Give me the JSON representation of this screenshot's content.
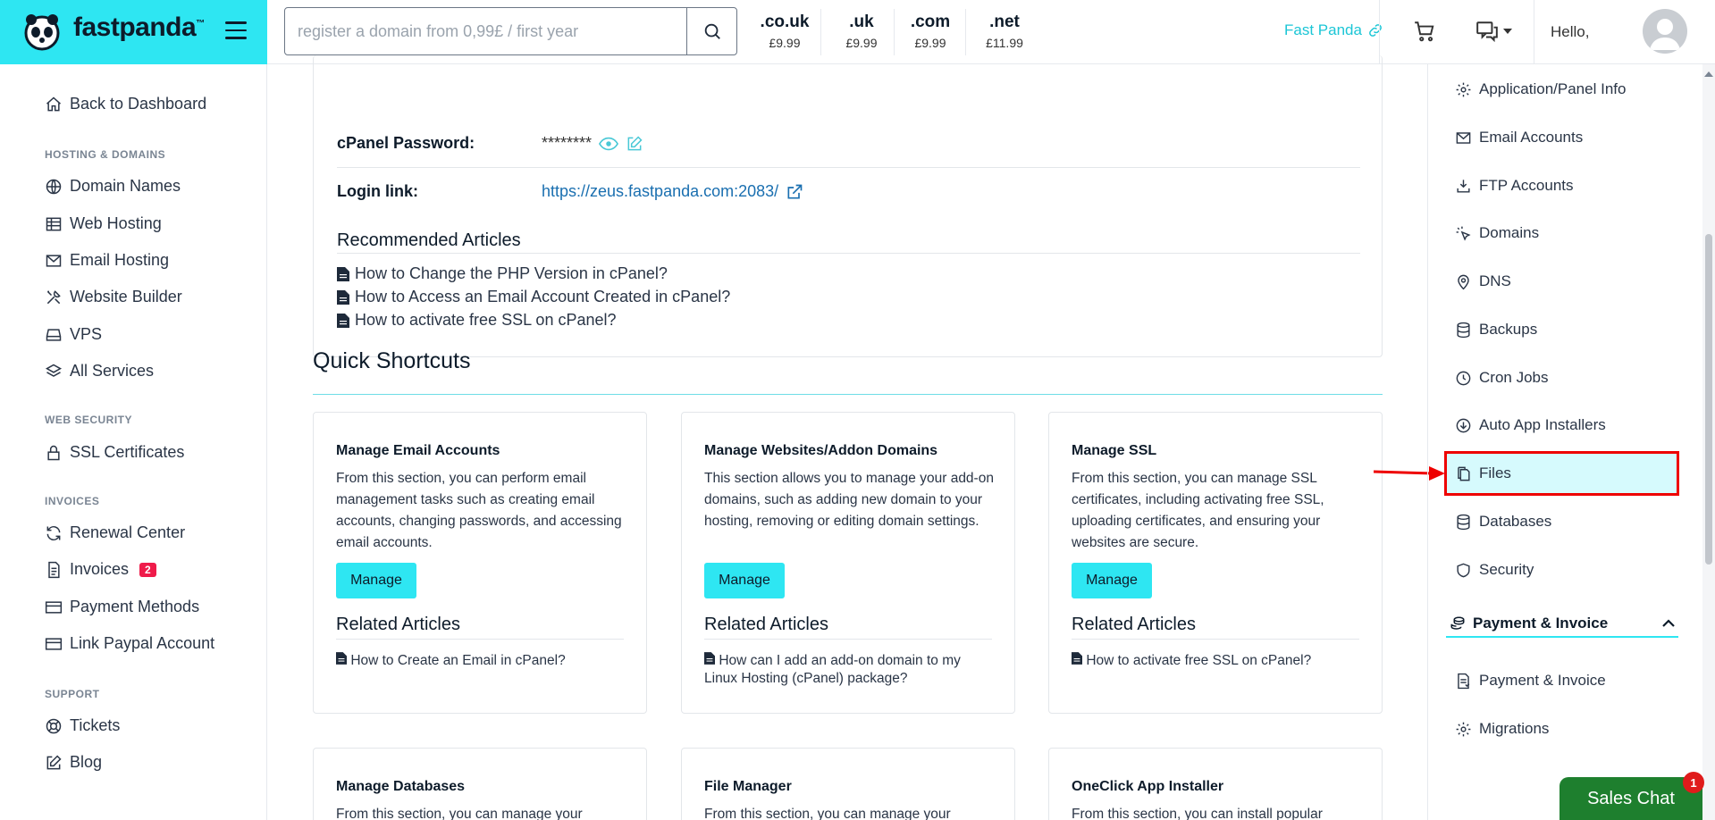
{
  "header": {
    "logo_text": "fastpanda",
    "logo_tm": "™",
    "search_placeholder": "register a domain from 0,99£ / first year",
    "tlds": [
      {
        "ext": ".co.uk",
        "price": "£9.99"
      },
      {
        "ext": ".uk",
        "price": "£9.99"
      },
      {
        "ext": ".com",
        "price": "£9.99"
      },
      {
        "ext": ".net",
        "price": "£11.99"
      }
    ],
    "account_link": "Fast Panda",
    "greeting": "Hello,"
  },
  "sidebar": {
    "back": "Back to Dashboard",
    "sections": [
      {
        "heading": "HOSTING & DOMAINS",
        "items": [
          "Domain Names",
          "Web Hosting",
          "Email Hosting",
          "Website Builder",
          "VPS",
          "All Services"
        ]
      },
      {
        "heading": "WEB SECURITY",
        "items": [
          "SSL Certificates"
        ]
      },
      {
        "heading": "INVOICES",
        "items": [
          "Renewal Center",
          "Invoices",
          "Payment Methods",
          "Link Paypal Account"
        ]
      },
      {
        "heading": "SUPPORT",
        "items": [
          "Tickets",
          "Blog"
        ]
      }
    ],
    "invoices_badge": "2"
  },
  "details": {
    "password_label": "cPanel Password:",
    "password_value": "********",
    "login_label": "Login link:",
    "login_value": "https://zeus.fastpanda.com:2083/",
    "recommended_title": "Recommended Articles",
    "articles": [
      "How to Change the PHP Version in cPanel?",
      "How to Access an Email Account Created in cPanel?",
      "How to activate free SSL on cPanel?"
    ]
  },
  "shortcuts": {
    "title": "Quick Shortcuts",
    "manage_label": "Manage",
    "related_label": "Related Articles",
    "cards": [
      {
        "title": "Manage Email Accounts",
        "desc": "From this section, you can perform email management tasks such as creating email accounts, changing passwords, and accessing email accounts.",
        "article": "How to Create an Email in cPanel?"
      },
      {
        "title": "Manage Websites/Addon Domains",
        "desc": "This section allows you to manage your add-on domains, such as adding new domain to your hosting, removing or editing domain settings.",
        "article": "How can I add an add-on domain to my Linux Hosting (cPanel) package?"
      },
      {
        "title": "Manage SSL",
        "desc": "From this section, you can manage SSL certificates, including activating free SSL, uploading certificates, and ensuring your websites are secure.",
        "article": "How to activate free SSL on cPanel?"
      },
      {
        "title": "Manage Databases",
        "desc": "From this section, you can manage your"
      },
      {
        "title": "File Manager",
        "desc": "From this section, you can manage your"
      },
      {
        "title": "OneClick App Installer",
        "desc": "From this section, you can install popular"
      }
    ]
  },
  "right_sidebar": {
    "items": [
      "Application/Panel Info",
      "Email Accounts",
      "FTP Accounts",
      "Domains",
      "DNS",
      "Backups",
      "Cron Jobs",
      "Auto App Installers",
      "Files",
      "Databases",
      "Security"
    ],
    "payment_heading": "Payment & Invoice",
    "payment_items": [
      "Payment & Invoice",
      "Migrations"
    ]
  },
  "chat": {
    "label": "Sales Chat",
    "badge": "1"
  },
  "colors": {
    "accent": "#2ee6f2",
    "highlight_border": "#ee0000",
    "chat_green": "#1e7f2e",
    "link": "#1a6fb0"
  }
}
